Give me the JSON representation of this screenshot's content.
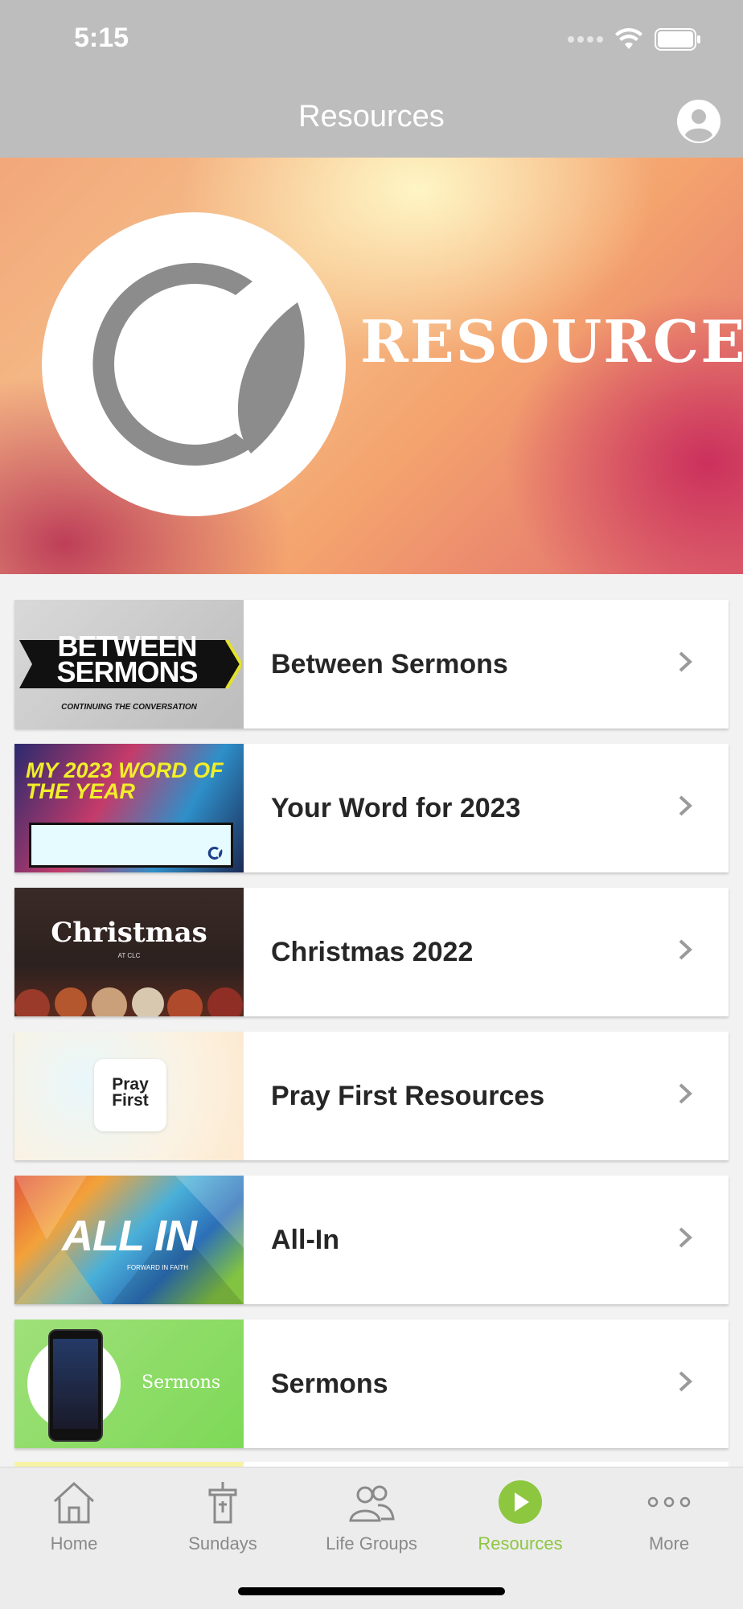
{
  "status_bar": {
    "time": "5:15"
  },
  "header": {
    "title": "Resources"
  },
  "hero": {
    "word": "RESOURCES"
  },
  "resources": [
    {
      "label": "Between Sermons",
      "thumb_text": "BETWEEN SERMONS",
      "thumb_sub": "CONTINUING THE CONVERSATION"
    },
    {
      "label": "Your Word for 2023",
      "thumb_text": "MY 2023 WORD OF THE YEAR"
    },
    {
      "label": "Christmas 2022",
      "thumb_text": "Christmas",
      "thumb_sub": "AT CLC"
    },
    {
      "label": "Pray First Resources",
      "thumb_text_1": "Pray",
      "thumb_text_2": "First"
    },
    {
      "label": "All-In",
      "thumb_text": "ALL IN",
      "thumb_sub": "FORWARD IN FAITH"
    },
    {
      "label": "Sermons",
      "thumb_text": "Sermons"
    }
  ],
  "tabs": [
    {
      "label": "Home",
      "icon": "house-icon"
    },
    {
      "label": "Sundays",
      "icon": "pulpit-icon"
    },
    {
      "label": "Life Groups",
      "icon": "people-icon"
    },
    {
      "label": "Resources",
      "icon": "play-icon",
      "active": true
    },
    {
      "label": "More",
      "icon": "dots-icon"
    }
  ],
  "colors": {
    "accent": "#8dc63f",
    "header": "#bdbdbd",
    "tab_inactive": "#8a8a8a"
  }
}
